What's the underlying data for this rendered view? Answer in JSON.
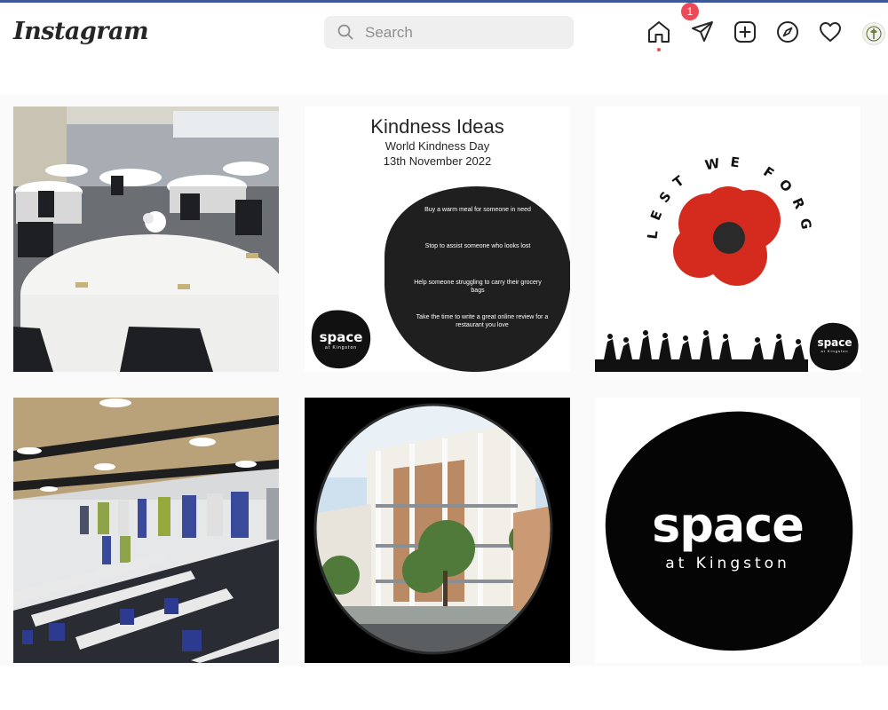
{
  "header": {
    "logo": "Instagram",
    "search": {
      "placeholder": "Search"
    },
    "nav": {
      "home": "home-icon",
      "direct": "paper-plane-icon",
      "direct_badge": "1",
      "new_post": "plus-square-icon",
      "explore": "compass-icon",
      "activity": "heart-icon",
      "profile": "avatar"
    }
  },
  "colors": {
    "badge": "#ed4956",
    "text": "#262626",
    "poppy": "#d52b1e"
  },
  "posts": {
    "kindness": {
      "title": "Kindness Ideas",
      "subtitle": "World Kindness Day",
      "date": "13th November 2022",
      "items": [
        "Buy a warm meal for someone in need",
        "Stop to assist someone who looks lost",
        "Help someone struggling to carry their grocery bags",
        "Take the time to write a great online review for a restaurant you love"
      ],
      "brand": "space",
      "brand_sub": "at Kingston"
    },
    "remembrance": {
      "text": "LEST WE FORGET",
      "brand": "space",
      "brand_sub": "at Kingston"
    },
    "logo_post": {
      "brand": "space",
      "brand_sub": "at Kingston"
    }
  }
}
